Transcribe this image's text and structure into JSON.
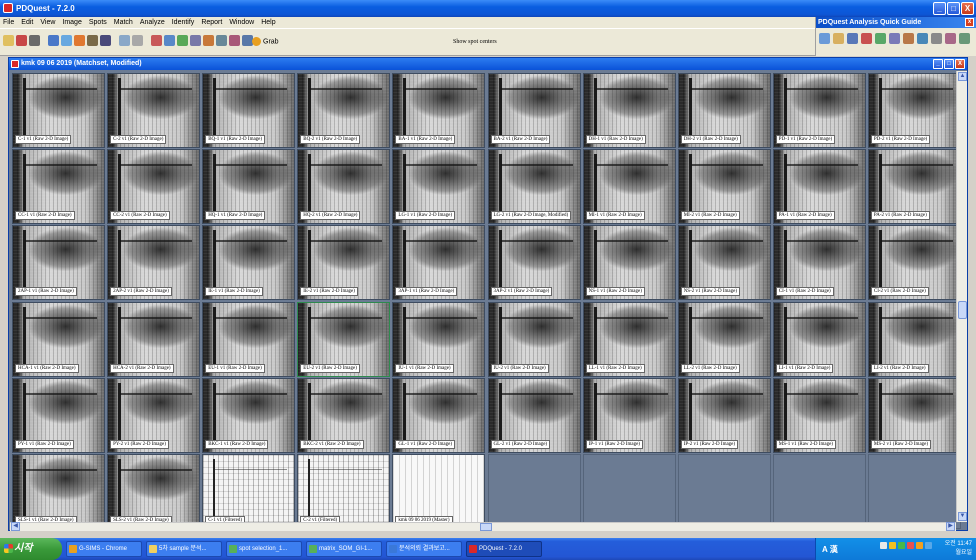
{
  "app": {
    "title": "PDQuest - 7.2.0"
  },
  "menu": [
    "File",
    "Edit",
    "View",
    "Image",
    "Spots",
    "Match",
    "Analyze",
    "Identify",
    "Report",
    "Window",
    "Help"
  ],
  "toolbar": {
    "grab_label": "Grab",
    "status_hint": "Show spot centers"
  },
  "guide": {
    "title": "PDQuest Analysis Quick Guide",
    "close": "x"
  },
  "window_buttons": {
    "minimize": "_",
    "maximize": "□",
    "close": "X"
  },
  "matchset": {
    "title": "kmk 09 06 2019 (Matchset, Modified)",
    "tiles": [
      {
        "label": "C-1 v1 (Raw 2-D Image)"
      },
      {
        "label": "C-2 v1 (Raw 2-D Image)"
      },
      {
        "label": "BQ-1 v1 (Raw 2-D Image)"
      },
      {
        "label": "BQ-2 v1 (Raw 2-D Image)"
      },
      {
        "label": "BA-1 v1 (Raw 2-D Image)"
      },
      {
        "label": "BA-2 v1 (Raw 2-D Image)"
      },
      {
        "label": "DH-1 v1 (Raw 2-D Image)"
      },
      {
        "label": "DH-2 v1 (Raw 2-D Image)"
      },
      {
        "label": "PD-1 v1 (Raw 2-D Image)"
      },
      {
        "label": "PD-2 v1 (Raw 2-D Image)"
      },
      {
        "label": "CC-1 v1 (Raw 2-D Image)"
      },
      {
        "label": "CC-2 v1 (Raw 2-D Image)"
      },
      {
        "label": "HQ-1 v1 (Raw 2-D Image)"
      },
      {
        "label": "HQ-2 v1 (Raw 2-D Image)"
      },
      {
        "label": "LG-1 v1 (Raw 2-D Image)"
      },
      {
        "label": "LG-2 v1 (Raw 2-D Image, Modified)"
      },
      {
        "label": "MI-1 v1 (Raw 2-D Image)"
      },
      {
        "label": "MI-2 v1 (Raw 2-D Image)"
      },
      {
        "label": "PA-1 v1 (Raw 2-D Image)"
      },
      {
        "label": "PA-2 v1 (Raw 2-D Image)"
      },
      {
        "label": "2AP-1 v1 (Raw 2-D Image)"
      },
      {
        "label": "2AP-2 v1 (Raw 2-D Image)"
      },
      {
        "label": "IE-1 v1 (Raw 2-D Image)"
      },
      {
        "label": "IE-2 v1 (Raw 2-D Image)"
      },
      {
        "label": "3AP-1 v1 (Raw 2-D Image)"
      },
      {
        "label": "3AP-2 v1 (Raw 2-D Image)"
      },
      {
        "label": "NS-1 v1 (Raw 2-D Image)"
      },
      {
        "label": "NS-2 v1 (Raw 2-D Image)"
      },
      {
        "label": "CI-1 v1 (Raw 2-D Image)"
      },
      {
        "label": "CI-2 v1 (Raw 2-D Image)"
      },
      {
        "label": "HCA-1 v1 (Raw 2-D Image)"
      },
      {
        "label": "HCA-2 v1 (Raw 2-D Image)"
      },
      {
        "label": "EU-1 v1 (Raw 2-D Image)"
      },
      {
        "label": "EU-2 v1 (Raw 2-D Image)"
      },
      {
        "label": "IU-1 v1 (Raw 2-D Image)"
      },
      {
        "label": "IU-2 v1 (Raw 2-D Image)"
      },
      {
        "label": "LL-1 v1 (Raw 2-D Image)"
      },
      {
        "label": "LL-2 v1 (Raw 2-D Image)"
      },
      {
        "label": "LI-1 v1 (Raw 2-D Image)"
      },
      {
        "label": "LI-2 v1 (Raw 2-D Image)"
      },
      {
        "label": "PY-1 v1 (Raw 2-D Image)"
      },
      {
        "label": "PY-2 v1 (Raw 2-D Image)"
      },
      {
        "label": "BKC-1 v1 (Raw 2-D Image)"
      },
      {
        "label": "BKC-2 v1 (Raw 2-D Image)"
      },
      {
        "label": "GL-1 v1 (Raw 2-D Image)"
      },
      {
        "label": "GL-2 v1 (Raw 2-D Image)"
      },
      {
        "label": "IP-1 v1 (Raw 2-D Image)"
      },
      {
        "label": "IP-2 v1 (Raw 2-D Image)"
      },
      {
        "label": "MS-1 v1 (Raw 2-D Image)"
      },
      {
        "label": "MS-2 v1 (Raw 2-D Image)"
      },
      {
        "label": "SLS-1 v1 (Raw 2-D Image)"
      },
      {
        "label": "SLS-2 v1 (Raw 2-D Image)"
      },
      {
        "label": "C-1 v1 (Filtered)"
      },
      {
        "label": "C-2 v1 (Filtered)"
      },
      {
        "label": "kmk 09 06 2019 (Master)"
      }
    ]
  },
  "taskbar": {
    "start_label": "시작",
    "tasks": [
      {
        "label": "G-SIMS - Chrome",
        "color": "#e8a020"
      },
      {
        "label": "5차 sample 분석...",
        "color": "#f0d060"
      },
      {
        "label": "spot selection_1...",
        "color": "#58b058"
      },
      {
        "label": "matrix_SOM_GI-1...",
        "color": "#58b058"
      },
      {
        "label": "분석의뢰 결과보고...",
        "color": "#3a78d8"
      },
      {
        "label": "PDQuest - 7.2.0",
        "color": "#d82828"
      }
    ],
    "ime": "A 漢",
    "clock_time": "오전 11:47",
    "clock_day": "월요일"
  }
}
